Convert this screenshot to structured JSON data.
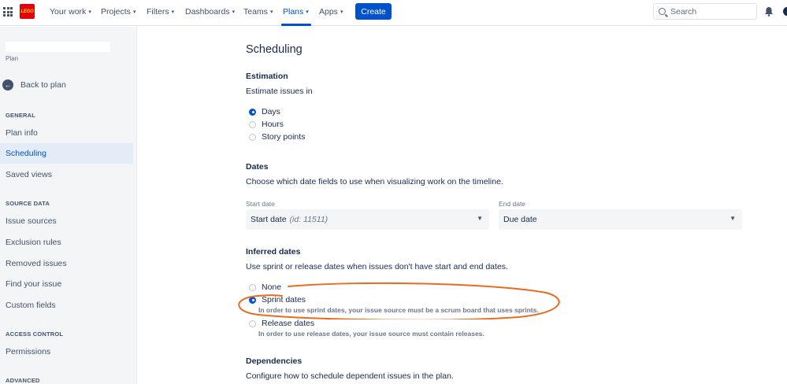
{
  "topnav": {
    "logo_text": "LEGO",
    "items": [
      {
        "label": "Your work"
      },
      {
        "label": "Projects"
      },
      {
        "label": "Filters"
      },
      {
        "label": "Dashboards"
      },
      {
        "label": "Teams"
      },
      {
        "label": "Plans"
      },
      {
        "label": "Apps"
      }
    ],
    "create_label": "Create",
    "search_placeholder": "Search",
    "accent": "#0052cc"
  },
  "sidebar": {
    "plan_label": "Plan",
    "back_label": "Back to plan",
    "sections": [
      {
        "title": "GENERAL",
        "items": [
          "Plan info",
          "Scheduling",
          "Saved views"
        ]
      },
      {
        "title": "SOURCE DATA",
        "items": [
          "Issue sources",
          "Exclusion rules",
          "Removed issues",
          "Find your issue",
          "Custom fields"
        ]
      },
      {
        "title": "ACCESS CONTROL",
        "items": [
          "Permissions"
        ]
      },
      {
        "title": "ADVANCED",
        "items": []
      }
    ],
    "selected": "Scheduling"
  },
  "main": {
    "title": "Scheduling",
    "estimation": {
      "heading": "Estimation",
      "description": "Estimate issues in",
      "options": [
        "Days",
        "Hours",
        "Story points"
      ],
      "selected": "Days"
    },
    "dates": {
      "heading": "Dates",
      "description": "Choose which date fields to use when visualizing work on the timeline.",
      "start_label": "Start date",
      "start_value": "Start date",
      "start_hint": "(id: 11511)",
      "end_label": "End date",
      "end_value": "Due date"
    },
    "inferred": {
      "heading": "Inferred dates",
      "description": "Use sprint or release dates when issues don't have start and end dates.",
      "options": [
        {
          "label": "None",
          "help": ""
        },
        {
          "label": "Sprint dates",
          "help": "In order to use sprint dates, your issue source must be a scrum board that uses sprints."
        },
        {
          "label": "Release dates",
          "help": "In order to use release dates, your issue source must contain releases."
        }
      ],
      "selected": "Sprint dates"
    },
    "dependencies": {
      "heading": "Dependencies",
      "description": "Configure how to schedule dependent issues in the plan."
    }
  },
  "annotation_color": "#ec6a1e"
}
